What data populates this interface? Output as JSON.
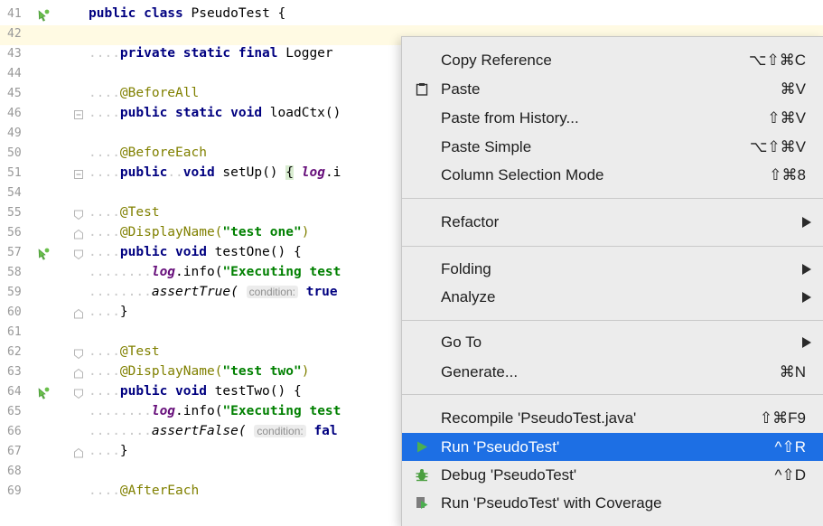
{
  "editor": {
    "lines": [
      {
        "n": "41",
        "runIcon": true
      },
      {
        "n": "42",
        "caret": true
      },
      {
        "n": "43"
      },
      {
        "n": "44"
      },
      {
        "n": "45"
      },
      {
        "n": "46",
        "fold": "box"
      },
      {
        "n": "49"
      },
      {
        "n": "50"
      },
      {
        "n": "51",
        "fold": "box"
      },
      {
        "n": "54"
      },
      {
        "n": "55",
        "fold": "open"
      },
      {
        "n": "56",
        "fold": "mid"
      },
      {
        "n": "57",
        "runIcon": true,
        "fold": "mid"
      },
      {
        "n": "58"
      },
      {
        "n": "59"
      },
      {
        "n": "60",
        "fold": "close"
      },
      {
        "n": "61"
      },
      {
        "n": "62",
        "fold": "open"
      },
      {
        "n": "63",
        "fold": "mid"
      },
      {
        "n": "64",
        "runIcon": true,
        "fold": "mid"
      },
      {
        "n": "65"
      },
      {
        "n": "66"
      },
      {
        "n": "67",
        "fold": "close"
      },
      {
        "n": "68"
      },
      {
        "n": "69"
      }
    ],
    "code": {
      "l41_kw": "public class",
      "l41_rest": " PseudoTest {",
      "l43_kw": "private static final",
      "l43_rest": " Logger ",
      "l45_ann": "@BeforeAll",
      "l46_kw": "public static void",
      "l46_rest": " loadCtx()",
      "l50_ann": "@BeforeEach",
      "l51_kw1": "public",
      "l51_kw2": "void",
      "l51_rest": " setUp() ",
      "l51_brace": "{",
      "l51_log": "log",
      "l51_tail": ".i",
      "l55_ann": "@Test",
      "l56_ann": "@DisplayName(",
      "l56_str": "\"test one\"",
      "l56_close": ")",
      "l57_kw": "public void",
      "l57_rest": " testOne() {",
      "l58_log": "log",
      "l58_mid": ".info(",
      "l58_str": "\"Executing test",
      "l59_call": "assertTrue(",
      "l59_hint": "condition:",
      "l59_val": "true",
      "l60_brace": "}",
      "l62_ann": "@Test",
      "l63_ann": "@DisplayName(",
      "l63_str": "\"test two\"",
      "l63_close": ")",
      "l64_kw": "public void",
      "l64_rest": " testTwo() {",
      "l65_log": "log",
      "l65_mid": ".info(",
      "l65_str": "\"Executing test",
      "l66_call": "assertFalse(",
      "l66_hint": "condition:",
      "l66_val": "fal",
      "l67_brace": "}",
      "l69_ann": "@AfterEach"
    }
  },
  "context_menu": {
    "items": [
      {
        "label": "Copy Reference",
        "shortcut": "⌥⇧⌘C"
      },
      {
        "label": "Paste",
        "shortcut": "⌘V",
        "icon": "clipboard-icon"
      },
      {
        "label": "Paste from History...",
        "shortcut": "⇧⌘V"
      },
      {
        "label": "Paste Simple",
        "shortcut": "⌥⇧⌘V"
      },
      {
        "label": "Column Selection Mode",
        "shortcut": "⇧⌘8"
      },
      {
        "label": "Refactor",
        "submenu": true
      },
      {
        "label": "Folding",
        "submenu": true
      },
      {
        "label": "Analyze",
        "submenu": true
      },
      {
        "label": "Go To",
        "submenu": true
      },
      {
        "label": "Generate...",
        "shortcut": "⌘N"
      },
      {
        "label": "Recompile 'PseudoTest.java'",
        "shortcut": "⇧⌘F9"
      },
      {
        "label": "Run 'PseudoTest'",
        "shortcut": "^⇧R",
        "icon": "run-icon",
        "selected": true
      },
      {
        "label": "Debug 'PseudoTest'",
        "shortcut": "^⇧D",
        "icon": "debug-icon"
      },
      {
        "label": "Run 'PseudoTest' with Coverage",
        "icon": "coverage-icon"
      }
    ]
  },
  "colors": {
    "keyword": "#000080",
    "annotation": "#808000",
    "string": "#008000",
    "selection": "#1d6fe4",
    "run_icon": "#4caf50",
    "debug_icon": "#4a9e3f"
  }
}
